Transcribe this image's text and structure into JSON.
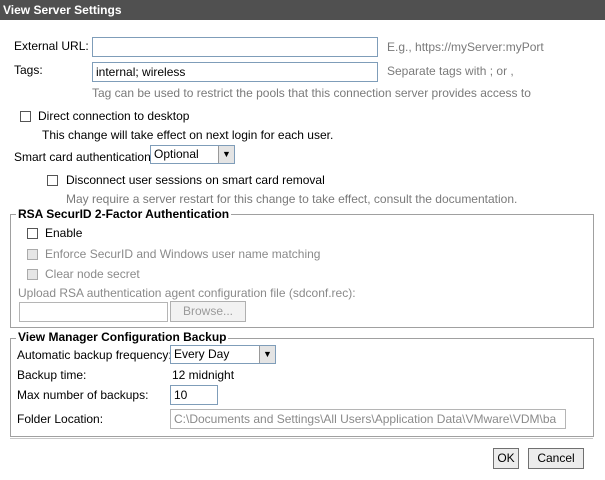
{
  "window": {
    "title": "View Server Settings"
  },
  "external_url": {
    "label": "External URL:",
    "value": "",
    "hint": "E.g., https://myServer:myPort"
  },
  "tags": {
    "label": "Tags:",
    "value": "internal; wireless",
    "hint": "Separate tags with ; or ,",
    "note": "Tag can be used to restrict the pools that this connection server provides access to"
  },
  "direct_connection": {
    "label": "Direct connection to desktop",
    "note": "This change will take effect on next login for each user.",
    "checked": false
  },
  "smart_card": {
    "label": "Smart card authentication:",
    "selected": "Optional",
    "disconnect_label": "Disconnect user sessions on smart card removal",
    "note": "May require a server restart for this change to take effect, consult the documentation."
  },
  "rsa": {
    "legend": "RSA SecurID 2-Factor Authentication",
    "enable_label": "Enable",
    "enforce_label": "Enforce SecurID and Windows user name matching",
    "clear_label": "Clear node secret",
    "upload_label": "Upload RSA authentication agent configuration file (sdconf.rec):",
    "file_value": "",
    "browse_label": "Browse..."
  },
  "backup": {
    "legend": "View Manager Configuration Backup",
    "frequency_label": "Automatic backup frequency:",
    "frequency_value": "Every Day",
    "time_label": "Backup time:",
    "time_value": "12 midnight",
    "max_label": "Max number of backups:",
    "max_value": "10",
    "folder_label": "Folder Location:",
    "folder_value": "C:\\Documents and Settings\\All Users\\Application Data\\VMware\\VDM\\ba"
  },
  "buttons": {
    "ok": "OK",
    "cancel": "Cancel"
  }
}
